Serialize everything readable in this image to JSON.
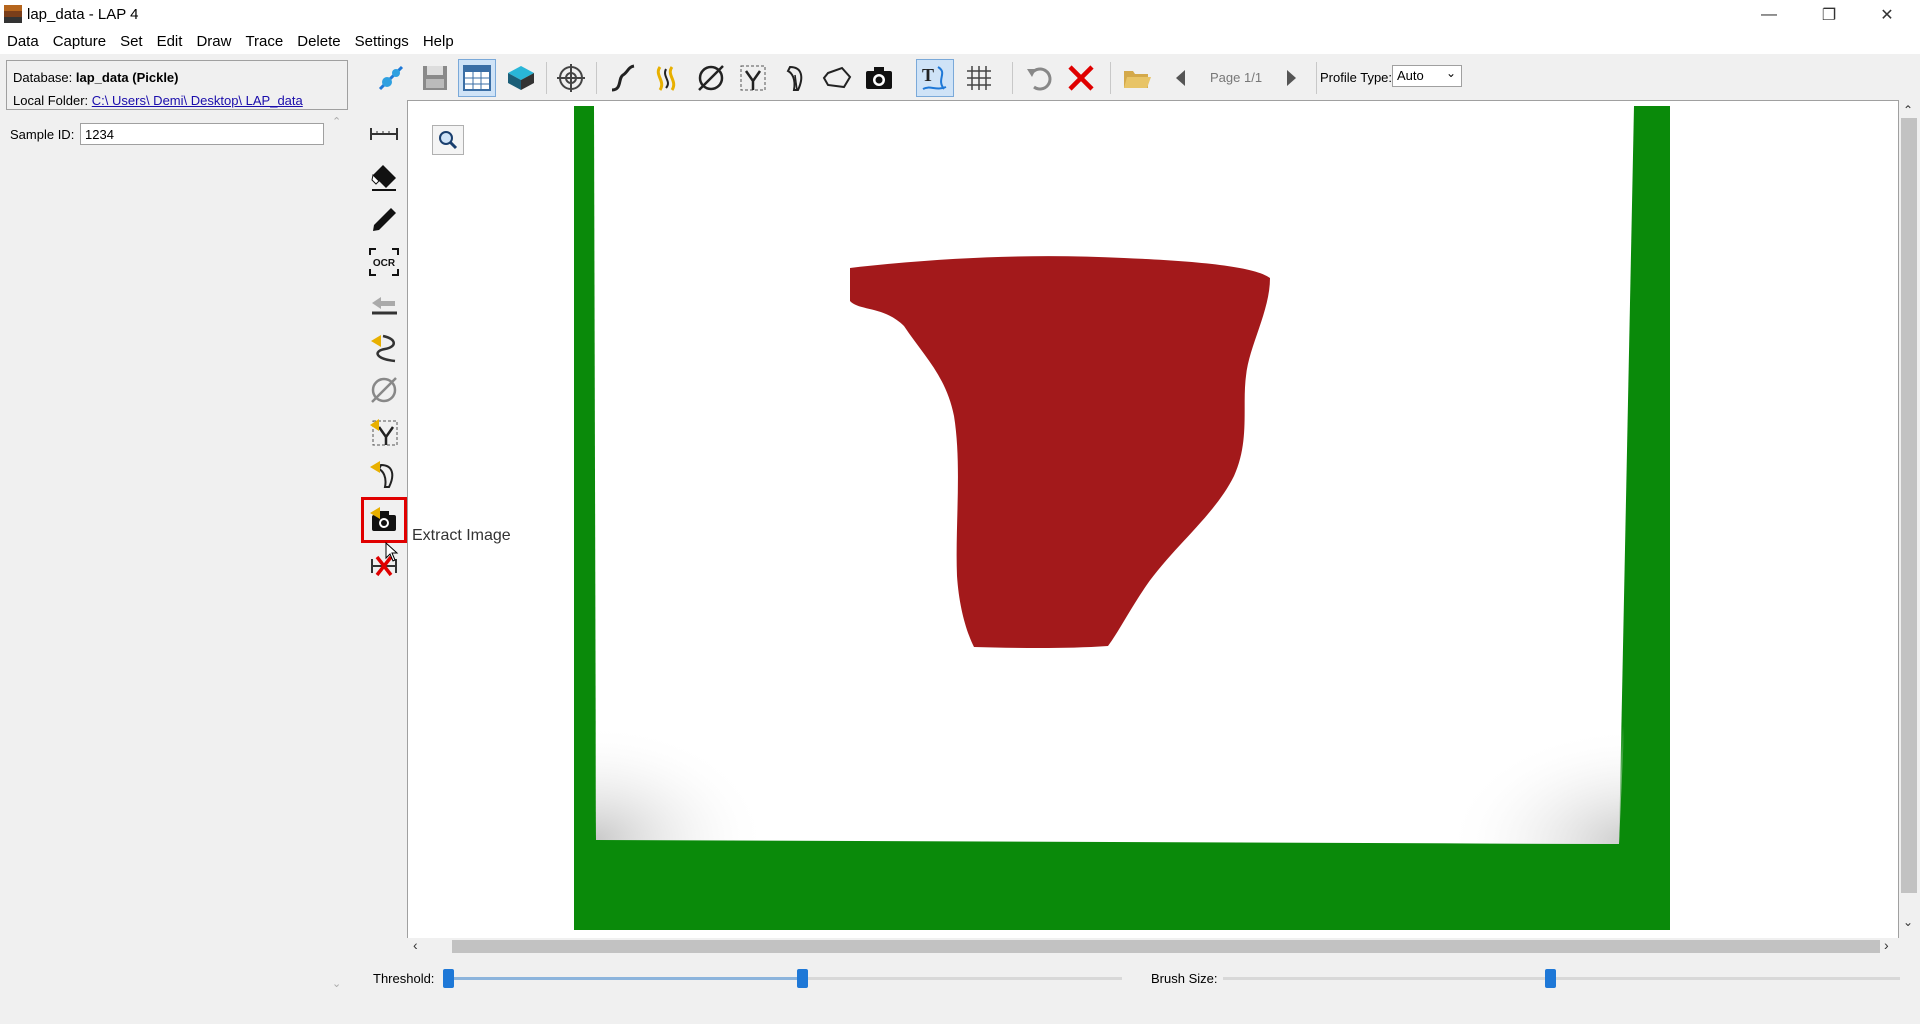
{
  "window": {
    "title": "lap_data - LAP 4",
    "minimize": "—",
    "restore": "❐",
    "close": "✕"
  },
  "menu": [
    "Data",
    "Capture",
    "Set",
    "Edit",
    "Draw",
    "Trace",
    "Delete",
    "Settings",
    "Help"
  ],
  "database": {
    "label": "Database:",
    "name": "lap_data (Pickle)",
    "folder_label": "Local Folder:",
    "folder_path": "C:\\ Users\\ Demi\\ Desktop\\ LAP_data"
  },
  "sample": {
    "label": "Sample ID:",
    "value": "1234"
  },
  "toolbar": {
    "page": "Page 1/1",
    "profile_label": "Profile Type:",
    "profile_value": "Auto",
    "icons": [
      "connect-icon",
      "save-icon",
      "table-icon",
      "layer-icon",
      "target-icon",
      "curve-icon",
      "trace-curve-icon",
      "diameter-icon",
      "select-icon",
      "nib-icon",
      "shape-icon",
      "camera-icon",
      "text-trace-icon",
      "grid-icon",
      "undo-icon",
      "delete-icon",
      "folder-icon",
      "prev-page-icon",
      "next-page-icon"
    ]
  },
  "side_tools": [
    "ruler-icon",
    "eraser-icon",
    "pencil-icon",
    "ocr-icon",
    "delete-line-icon",
    "delete-curve-icon",
    "delete-diameter-icon",
    "delete-select-icon",
    "delete-nib-icon",
    "extract-image-icon",
    "delete-all-icon"
  ],
  "tooltip": "Extract Image",
  "ocr_text": "OCR",
  "sliders": {
    "threshold_label": "Threshold:",
    "threshold_min": 0.0,
    "threshold_value": 0.53,
    "brush_label": "Brush Size:",
    "brush_value": 0.49
  },
  "colors": {
    "accent": "#1e78d7",
    "highlight": "#e00000",
    "sherd": "#a3191b",
    "background_green": "#008800"
  }
}
